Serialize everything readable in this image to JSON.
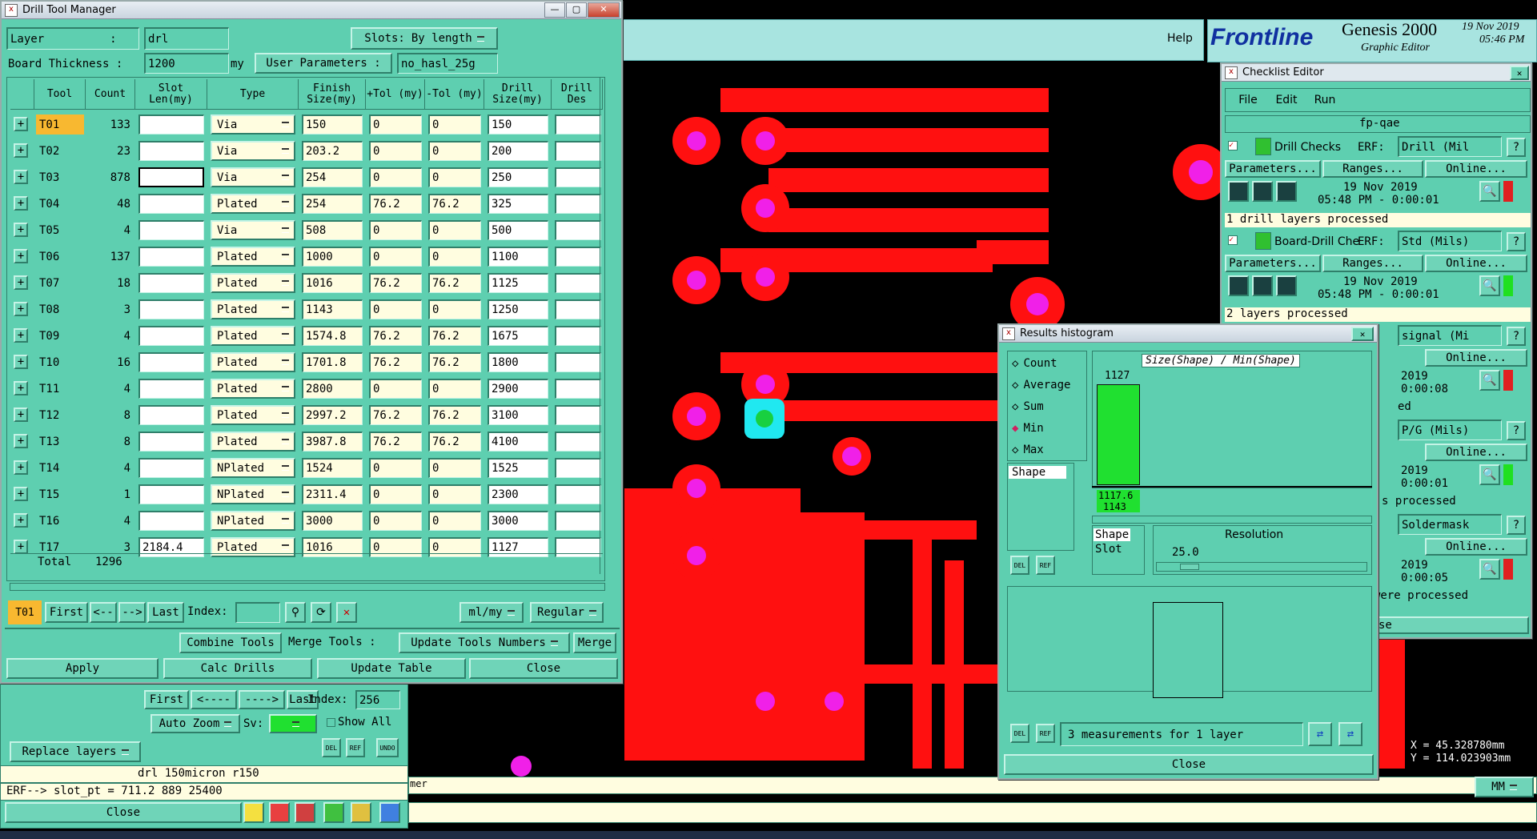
{
  "drill_window": {
    "title": "Drill Tool Manager",
    "layer_label": "Layer",
    "layer_colon": ":",
    "layer_value": "drl",
    "slots_label": "Slots:",
    "slots_value": "By length",
    "thickness_label": "Board Thickness :",
    "thickness_value": "1200",
    "thickness_unit": "my",
    "user_params_label": "User Parameters :",
    "user_params_value": "no_hasl_25g",
    "columns": [
      "Tool",
      "Count",
      "Slot Len(my)",
      "Type",
      "Finish Size(my)",
      "+Tol (my)",
      "-Tol (my)",
      "Drill Size(my)",
      "Drill Des"
    ],
    "rows": [
      {
        "tool": "T01",
        "count": "133",
        "slot": "",
        "type": "Via",
        "finish": "150",
        "ptol": "0",
        "ntol": "0",
        "drill": "150"
      },
      {
        "tool": "T02",
        "count": "23",
        "slot": "",
        "type": "Via",
        "finish": "203.2",
        "ptol": "0",
        "ntol": "0",
        "drill": "200"
      },
      {
        "tool": "T03",
        "count": "878",
        "slot": "",
        "type": "Via",
        "finish": "254",
        "ptol": "0",
        "ntol": "0",
        "drill": "250"
      },
      {
        "tool": "T04",
        "count": "48",
        "slot": "",
        "type": "Plated",
        "finish": "254",
        "ptol": "76.2",
        "ntol": "76.2",
        "drill": "325"
      },
      {
        "tool": "T05",
        "count": "4",
        "slot": "",
        "type": "Via",
        "finish": "508",
        "ptol": "0",
        "ntol": "0",
        "drill": "500"
      },
      {
        "tool": "T06",
        "count": "137",
        "slot": "",
        "type": "Plated",
        "finish": "1000",
        "ptol": "0",
        "ntol": "0",
        "drill": "1100"
      },
      {
        "tool": "T07",
        "count": "18",
        "slot": "",
        "type": "Plated",
        "finish": "1016",
        "ptol": "76.2",
        "ntol": "76.2",
        "drill": "1125"
      },
      {
        "tool": "T08",
        "count": "3",
        "slot": "",
        "type": "Plated",
        "finish": "1143",
        "ptol": "0",
        "ntol": "0",
        "drill": "1250"
      },
      {
        "tool": "T09",
        "count": "4",
        "slot": "",
        "type": "Plated",
        "finish": "1574.8",
        "ptol": "76.2",
        "ntol": "76.2",
        "drill": "1675"
      },
      {
        "tool": "T10",
        "count": "16",
        "slot": "",
        "type": "Plated",
        "finish": "1701.8",
        "ptol": "76.2",
        "ntol": "76.2",
        "drill": "1800"
      },
      {
        "tool": "T11",
        "count": "4",
        "slot": "",
        "type": "Plated",
        "finish": "2800",
        "ptol": "0",
        "ntol": "0",
        "drill": "2900"
      },
      {
        "tool": "T12",
        "count": "8",
        "slot": "",
        "type": "Plated",
        "finish": "2997.2",
        "ptol": "76.2",
        "ntol": "76.2",
        "drill": "3100"
      },
      {
        "tool": "T13",
        "count": "8",
        "slot": "",
        "type": "Plated",
        "finish": "3987.8",
        "ptol": "76.2",
        "ntol": "76.2",
        "drill": "4100"
      },
      {
        "tool": "T14",
        "count": "4",
        "slot": "",
        "type": "NPlated",
        "finish": "1524",
        "ptol": "0",
        "ntol": "0",
        "drill": "1525"
      },
      {
        "tool": "T15",
        "count": "1",
        "slot": "",
        "type": "NPlated",
        "finish": "2311.4",
        "ptol": "0",
        "ntol": "0",
        "drill": "2300"
      },
      {
        "tool": "T16",
        "count": "4",
        "slot": "",
        "type": "NPlated",
        "finish": "3000",
        "ptol": "0",
        "ntol": "0",
        "drill": "3000"
      },
      {
        "tool": "T17",
        "count": "3",
        "slot": "2184.4",
        "type": "Plated",
        "finish": "1016",
        "ptol": "0",
        "ntol": "0",
        "drill": "1127"
      }
    ],
    "total_label": "Total",
    "total_count": "1296",
    "nav": {
      "current": "T01",
      "first": "First",
      "prev": "<--",
      "next": "-->",
      "last": "Last",
      "index_label": "Index:",
      "index_value": "",
      "units": "ml/my",
      "mode": "Regular"
    },
    "combine_tools": "Combine Tools",
    "merge_tools": "Merge Tools :",
    "update_numbers": "Update Tools Numbers",
    "merge": "Merge",
    "apply": "Apply",
    "calc_drills": "Calc Drills",
    "update_table": "Update Table",
    "close": "Close"
  },
  "main_app": {
    "help": "Help",
    "brand": "Frontline",
    "product": "Genesis 2000",
    "subtitle": "Graphic Editor",
    "date": "19 Nov 2019",
    "time": "05:46 PM"
  },
  "lower_panel": {
    "first": "First",
    "prev": "<----",
    "next": "---->",
    "last": "Last",
    "index_label": "Index:",
    "index_value": "256",
    "auto_zoom": "Auto Zoom",
    "sv_label": "Sv:",
    "show_all": "Show All",
    "replace_layers": "Replace layers",
    "status_line": "drl 150micron r150",
    "erf_line": "ERF--> slot_pt = 711.2 889 25400",
    "close": "Close",
    "hint_text": "mer"
  },
  "checklist": {
    "title": "Checklist Editor",
    "menu": [
      "File",
      "Edit",
      "Run"
    ],
    "name": "fp-qae",
    "items": [
      {
        "name": "Drill Checks",
        "erf": "Drill (Mil",
        "date": "19 Nov 2019",
        "time": "05:48 PM - 0:00:01",
        "status": "1 drill layers processed"
      },
      {
        "name": "Board-Drill Che",
        "erf": "Std (Mils)",
        "date": "19 Nov 2019",
        "time": "05:48 PM - 0:00:01",
        "status": "2 layers processed"
      }
    ],
    "partial": [
      {
        "erf": "signal (Mi",
        "date": "2019",
        "time": "0:00:08",
        "status": "ed"
      },
      {
        "erf": "P/G (Mils)",
        "date": "2019",
        "time": "0:00:01",
        "status": "s processed"
      },
      {
        "erf": "Soldermask",
        "date": "2019",
        "time": "0:00:05",
        "status": "were processed"
      }
    ],
    "erf_label": "ERF:",
    "parameters": "Parameters...",
    "ranges": "Ranges...",
    "online": "Online...",
    "bottom_close": "se"
  },
  "histogram": {
    "title": "Results histogram",
    "options": [
      "Count",
      "Average",
      "Sum",
      "Min",
      "Max"
    ],
    "selected": "Min",
    "list_left": [
      "Shape"
    ],
    "chart_title": "Size(Shape) / Min(Shape)",
    "bar_value": "1127",
    "bar_range_lo": "1117.6",
    "bar_range_hi": "1143",
    "list_right": [
      "Shape",
      "Slot"
    ],
    "resolution_label": "Resolution",
    "resolution_value": "25.0",
    "measurements": "3 measurements for 1 layer",
    "close": "Close",
    "del": "DEL",
    "ref": "REF"
  },
  "coords": {
    "x": "X = 45.328780mm",
    "y": "Y = 114.023903mm",
    "units": "MM"
  }
}
